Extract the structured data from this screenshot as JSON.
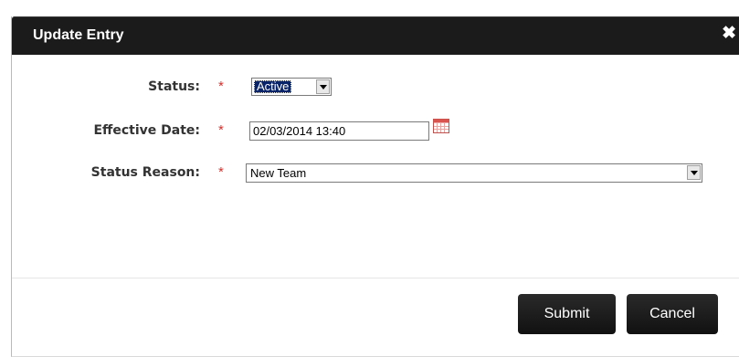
{
  "dialog": {
    "title": "Update Entry",
    "close_glyph": "✖"
  },
  "form": {
    "required_marker": "*",
    "status": {
      "label": "Status:",
      "value": "Active"
    },
    "effective_date": {
      "label": "Effective Date:",
      "value": "02/03/2014 13:40",
      "icon": "calendar-icon"
    },
    "status_reason": {
      "label": "Status Reason:",
      "value": "New Team"
    }
  },
  "buttons": {
    "submit": "Submit",
    "cancel": "Cancel"
  },
  "colors": {
    "titlebar": "#1b1b1b",
    "required": "#d9302c",
    "selection": "#0a246a",
    "button": "#1a1a1a"
  }
}
